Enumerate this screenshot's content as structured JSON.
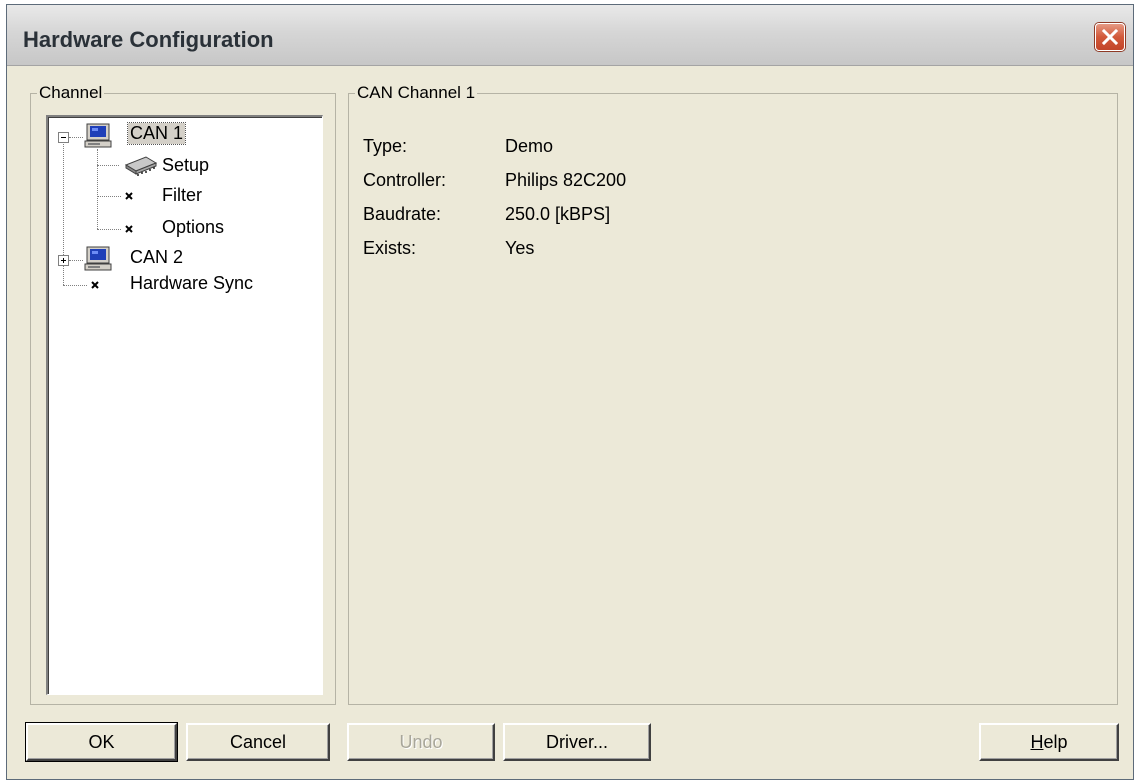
{
  "window": {
    "title": "Hardware Configuration"
  },
  "channel_group": {
    "label": "Channel",
    "tree": {
      "can1": {
        "label": "CAN 1",
        "icon": "computer-icon",
        "expanded": true,
        "selected": true
      },
      "setup": {
        "label": "Setup",
        "icon": "chip-icon"
      },
      "filter": {
        "label": "Filter",
        "icon": "bullet-icon"
      },
      "options": {
        "label": "Options",
        "icon": "bullet-icon"
      },
      "can2": {
        "label": "CAN 2",
        "icon": "computer-icon",
        "expanded": false
      },
      "hardware_sync": {
        "label": "Hardware Sync",
        "icon": "bullet-icon"
      }
    }
  },
  "details_group": {
    "label": "CAN Channel 1",
    "properties": [
      {
        "label": "Type:",
        "value": "Demo"
      },
      {
        "label": "Controller:",
        "value": "Philips 82C200"
      },
      {
        "label": "Baudrate:",
        "value": "250.0 [kBPS]"
      },
      {
        "label": "Exists:",
        "value": "Yes"
      }
    ]
  },
  "buttons": {
    "ok": "OK",
    "cancel": "Cancel",
    "undo": "Undo",
    "driver": "Driver...",
    "help_accel": "H",
    "help_rest": "elp"
  },
  "colors": {
    "dialog_bg": "#ece9d8",
    "close_button": "#d2593a"
  }
}
